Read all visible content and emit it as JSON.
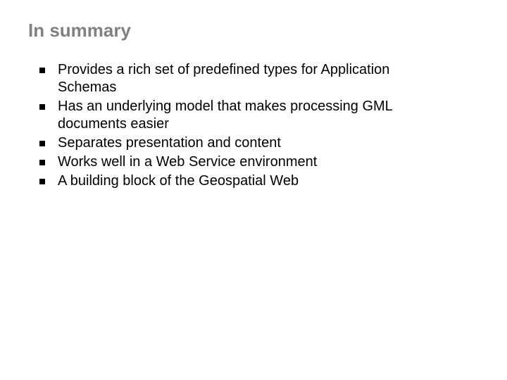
{
  "title": "In summary",
  "bullets": [
    "Provides a rich set of predefined types for Application Schemas",
    "Has an underlying model that makes processing GML documents easier",
    "Separates presentation and content",
    "Works well in a Web Service environment",
    "A building block of the Geospatial Web"
  ]
}
